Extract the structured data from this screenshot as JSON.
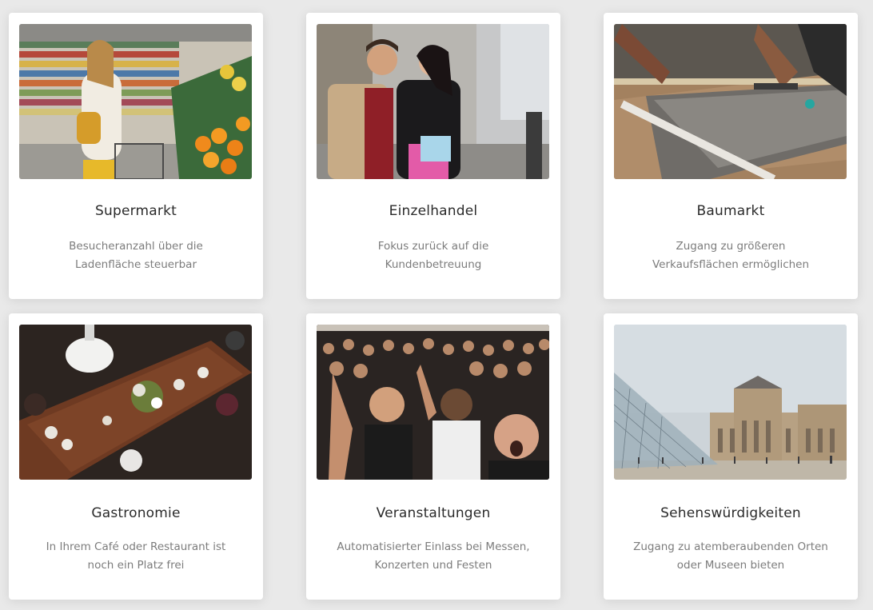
{
  "cards": [
    {
      "title": "Supermarkt",
      "desc_line1": "Besucheranzahl über die",
      "desc_line2": "Ladenfläche steuerbar"
    },
    {
      "title": "Einzelhandel",
      "desc_line1": "Fokus zurück auf die",
      "desc_line2": "Kundenbetreuung"
    },
    {
      "title": "Baumarkt",
      "desc_line1": "Zugang zu größeren",
      "desc_line2": "Verkaufsflächen ermöglichen"
    },
    {
      "title": "Gastronomie",
      "desc_line1": "In Ihrem Café oder Restaurant ist",
      "desc_line2": "noch ein Platz frei"
    },
    {
      "title": "Veranstaltungen",
      "desc_line1": "Automatisierter Einlass bei Messen,",
      "desc_line2": "Konzerten und Festen"
    },
    {
      "title": "Sehenswürdigkeiten",
      "desc_line1": "Zugang zu atemberaubenden Orten",
      "desc_line2": "oder Museen bieten"
    }
  ]
}
